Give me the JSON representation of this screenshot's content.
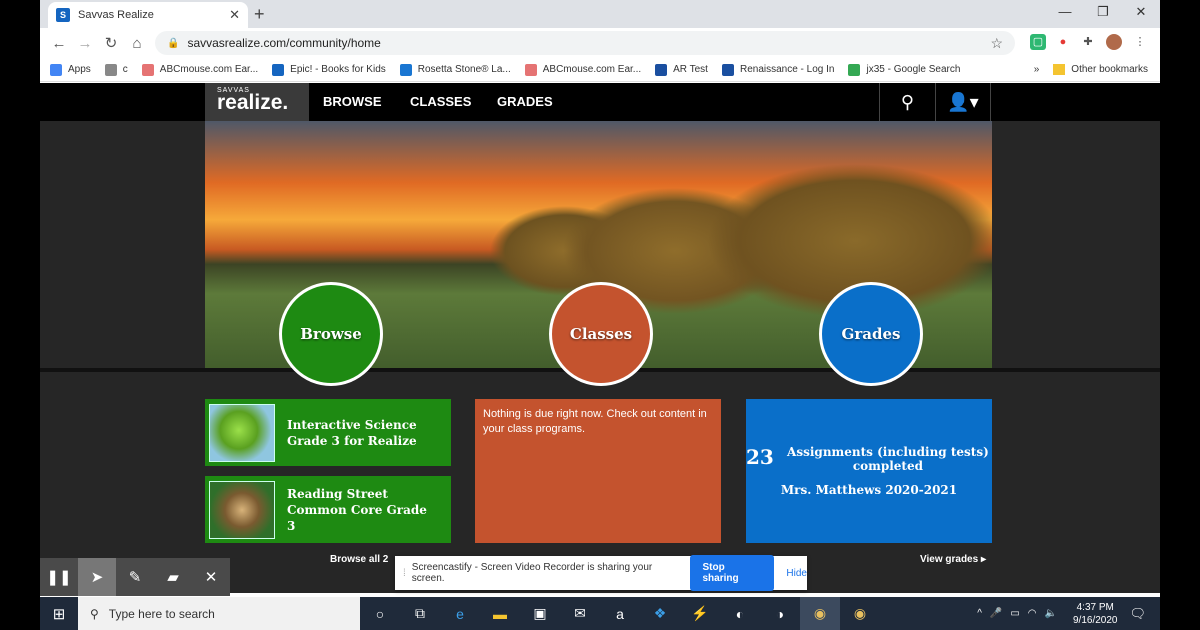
{
  "browser": {
    "tab_title": "Savvas Realize",
    "tab_favicon": "S",
    "url": "savvasrealize.com/community/home",
    "bookmarks": [
      {
        "label": "Apps",
        "color": "#4285f4"
      },
      {
        "label": "c",
        "color": "#888"
      },
      {
        "label": "ABCmouse.com Ear...",
        "color": "#e57373"
      },
      {
        "label": "Epic! - Books for Kids",
        "color": "#1565c0"
      },
      {
        "label": "Rosetta Stone® La...",
        "color": "#1976d2"
      },
      {
        "label": "ABCmouse.com Ear...",
        "color": "#e57373"
      },
      {
        "label": "AR Test",
        "color": "#1a4fa0"
      },
      {
        "label": "Renaissance - Log In",
        "color": "#1a4fa0"
      },
      {
        "label": "jx35 - Google Search",
        "color": "#34a853"
      }
    ],
    "other_bookmarks": "Other bookmarks",
    "overflow": "»"
  },
  "nav": {
    "logo_small": "SAVVAS",
    "logo_big": "realize.",
    "browse": "BROWSE",
    "classes": "CLASSES",
    "grades": "GRADES"
  },
  "circles": {
    "browse": "Browse",
    "classes": "Classes",
    "grades": "Grades"
  },
  "programs": [
    {
      "title": "Interactive Science Grade 3 for Realize"
    },
    {
      "title": "Reading Street Common Core Grade 3"
    }
  ],
  "classes_card": {
    "message": "Nothing is due right now. Check out content in your class programs."
  },
  "grades_card": {
    "count": "23",
    "label": "Assignments (including tests) completed",
    "class_name": "Mrs. Matthews 2020-2021"
  },
  "links": {
    "browse_all": "Browse all 2",
    "view_grades": "View grades ▸"
  },
  "screencastify": {
    "message": "Screencastify - Screen Video Recorder is sharing your screen.",
    "stop": "Stop sharing",
    "hide": "Hide"
  },
  "taskbar": {
    "search_placeholder": "Type here to search",
    "time": "4:37 PM",
    "date": "9/16/2020"
  },
  "colors": {
    "browse": "#1e8a12",
    "classes": "#c4532e",
    "grades": "#0a6fc9"
  }
}
